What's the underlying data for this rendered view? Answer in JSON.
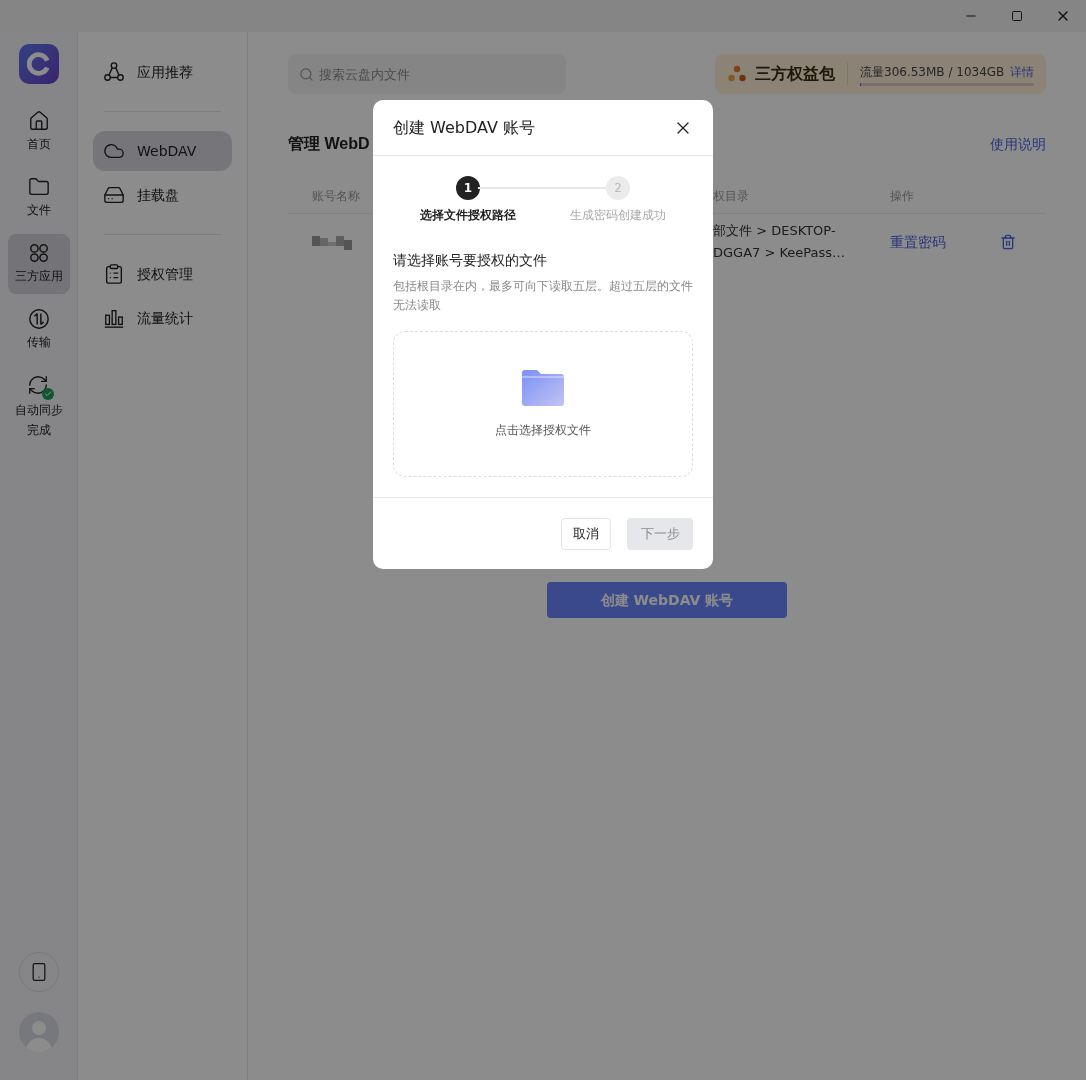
{
  "rail": {
    "items": [
      {
        "kind": "home",
        "label": "首页",
        "selected": false
      },
      {
        "kind": "folder",
        "label": "文件",
        "selected": false
      },
      {
        "kind": "apps",
        "label": "三方应用",
        "selected": true
      },
      {
        "kind": "transfer",
        "label": "传输",
        "selected": false
      },
      {
        "kind": "sync",
        "label": "自动同步完成",
        "selected": false
      }
    ]
  },
  "sidebar": {
    "groups": [
      [
        {
          "kind": "recommend",
          "label": "应用推荐",
          "selected": false
        }
      ],
      [
        {
          "kind": "cloud",
          "label": "WebDAV",
          "selected": true
        },
        {
          "kind": "disk",
          "label": "挂载盘",
          "selected": false
        }
      ],
      [
        {
          "kind": "clipboard",
          "label": "授权管理",
          "selected": false
        },
        {
          "kind": "chart",
          "label": "流量统计",
          "selected": false
        }
      ]
    ]
  },
  "search": {
    "placeholder": "搜索云盘内文件"
  },
  "benefit": {
    "title": "三方权益包",
    "usage": "流量306.53MB / 1034GB",
    "level": 0.004,
    "link": "详情"
  },
  "heading": "管理 WebD",
  "help_link": "使用说明",
  "table": {
    "columns": [
      "账号名称",
      "权目录",
      "操作"
    ],
    "rows": [
      {
        "path_lines": [
          "部文件 > DESKTOP-",
          "DGGA7 > KeePass…"
        ],
        "action": "重置密码"
      }
    ]
  },
  "create_button": "创建 WebDAV 账号",
  "dialog": {
    "title": "创建 WebDAV 账号",
    "steps": [
      {
        "number": "1",
        "label": "选择文件授权路径",
        "selected": true
      },
      {
        "number": "2",
        "label": "生成密码创建成功",
        "selected": false
      }
    ],
    "prompt": "请选择账号要授权的文件",
    "hint": "包括根目录在内，最多可向下读取五层。超过五层的文件无法读取",
    "drop_label": "点击选择授权文件",
    "cancel": "取消",
    "next": {
      "label": "下一步",
      "disabled": true
    }
  }
}
